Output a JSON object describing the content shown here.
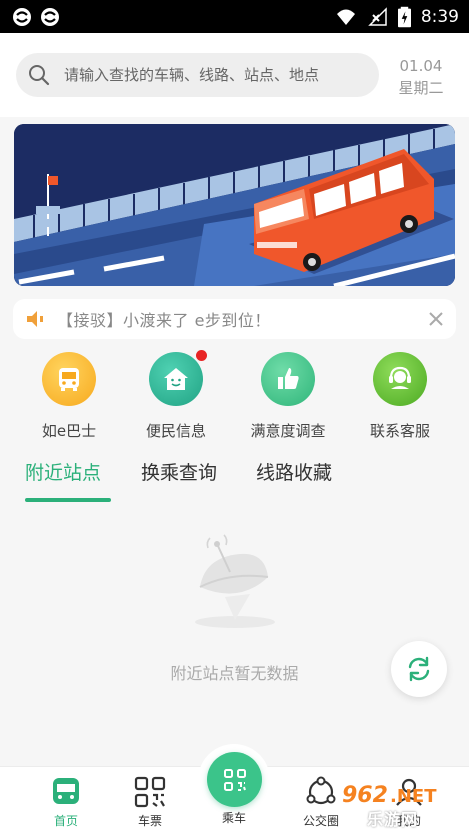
{
  "status_bar": {
    "time": "8:39",
    "icons": [
      "sync-icon",
      "sync-icon",
      "wifi-icon",
      "no-signal-icon",
      "battery-charging-icon"
    ]
  },
  "header": {
    "search": {
      "placeholder": "请输入查找的车辆、线路、站点、地点",
      "value": ""
    },
    "date": "01.04",
    "weekday": "星期二"
  },
  "notice": {
    "text": "【接驳】小渡来了 e步到位！"
  },
  "quick_menu": [
    {
      "label": "如e巴士",
      "icon": "bus-icon",
      "color": "#f8b92e"
    },
    {
      "label": "便民信息",
      "icon": "home-icon",
      "color": "#2fb89a",
      "badge": true
    },
    {
      "label": "满意度调查",
      "icon": "thumbs-up-icon",
      "color": "#3bc48a"
    },
    {
      "label": "联系客服",
      "icon": "headset-icon",
      "color": "#6cc43b"
    }
  ],
  "tabs": [
    {
      "label": "附近站点",
      "active": true
    },
    {
      "label": "换乘查询",
      "active": false
    },
    {
      "label": "线路收藏",
      "active": false
    }
  ],
  "empty_state": {
    "text": "附近站点暂无数据"
  },
  "bottom_nav": {
    "items": [
      {
        "label": "首页",
        "icon": "home-bus-icon",
        "active": true
      },
      {
        "label": "车票",
        "icon": "qr-code-icon",
        "active": false
      },
      {
        "label": "乘车",
        "icon": "scan-icon",
        "active": false
      },
      {
        "label": "公交圈",
        "icon": "circle-community-icon",
        "active": false
      },
      {
        "label": "我的",
        "icon": "user-icon",
        "active": false
      }
    ]
  },
  "watermark": {
    "brand": "962.NET",
    "subtitle": "乐游网"
  },
  "colors": {
    "accent": "#2bb07a",
    "banner_bg": "#1c2c63",
    "bus": "#f0572b"
  }
}
